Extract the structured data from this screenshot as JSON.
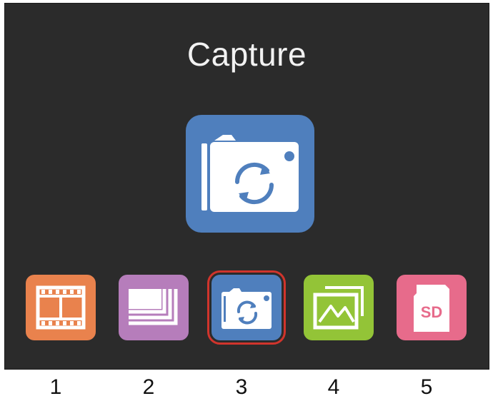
{
  "screen": {
    "title": "Capture"
  },
  "hero": {
    "icon": "camera-capture-icon",
    "color": "#4f7fbd"
  },
  "menu": {
    "selected_index": 3,
    "items": [
      {
        "number": "1",
        "icon": "film-strip-icon",
        "color": "#e9824d"
      },
      {
        "number": "2",
        "icon": "burst-frames-icon",
        "color": "#b67dbb"
      },
      {
        "number": "3",
        "icon": "camera-capture-icon",
        "color": "#4f7fbd"
      },
      {
        "number": "4",
        "icon": "gallery-icon",
        "color": "#93c437"
      },
      {
        "number": "5",
        "icon": "sd-card-icon",
        "color": "#e76b8b",
        "text": "SD"
      }
    ]
  },
  "colors": {
    "background": "#2b2b2b",
    "title_text": "#f2f2f2",
    "selection_border": "#d0342c"
  }
}
